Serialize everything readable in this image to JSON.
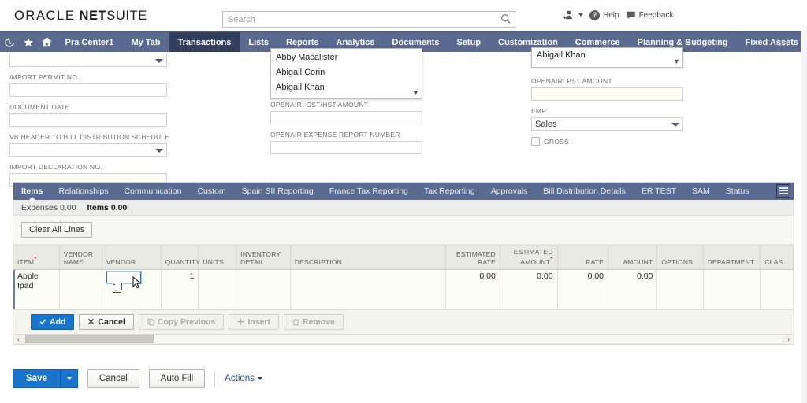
{
  "header": {
    "brand_oracle": "ORACLE",
    "brand_net": "NET",
    "brand_suite": "SUITE",
    "search_placeholder": "Search",
    "search_value": "",
    "help_label": "Help",
    "feedback_label": "Feedback"
  },
  "nav": {
    "items": [
      {
        "label": "Pra Center1",
        "active": false
      },
      {
        "label": "My Tab",
        "active": false
      },
      {
        "label": "Transactions",
        "active": true
      },
      {
        "label": "Lists",
        "active": false
      },
      {
        "label": "Reports",
        "active": false
      },
      {
        "label": "Analytics",
        "active": false
      },
      {
        "label": "Documents",
        "active": false
      },
      {
        "label": "Setup",
        "active": false
      },
      {
        "label": "Customization",
        "active": false
      },
      {
        "label": "Commerce",
        "active": false
      },
      {
        "label": "Planning & Budgeting",
        "active": false
      },
      {
        "label": "Fixed Assets",
        "active": false
      }
    ],
    "more": "..."
  },
  "form": {
    "left": [
      {
        "label": "",
        "type": "select",
        "value": ""
      },
      {
        "label": "IMPORT PERMIT NO.",
        "type": "text",
        "value": ""
      },
      {
        "label": "DOCUMENT DATE",
        "type": "text",
        "value": ""
      },
      {
        "label": "VB HEADER TO BILL DISTRIBUTION SCHEDULE",
        "type": "select",
        "value": ""
      },
      {
        "label": "IMPORT DECLARATION NO.",
        "type": "text",
        "value": ""
      }
    ],
    "mid": [
      {
        "label": "OPENAIR: GST/HST AMOUNT",
        "type": "text",
        "value": ""
      },
      {
        "label": "OPENAIR EXPENSE REPORT NUMBER",
        "type": "text",
        "value": ""
      }
    ],
    "right": [
      {
        "label": "OPENAIR: PST AMOUNT",
        "type": "text",
        "value": ""
      },
      {
        "label": "EMP",
        "type": "select",
        "value": "Sales"
      }
    ],
    "gross_label": "GROSS",
    "gross_checked": false
  },
  "autocomplete": {
    "items": [
      "Abby Macalister",
      "Abigail Corin",
      "Abigail Khan"
    ],
    "selected_right": "Abigail Khan"
  },
  "panel": {
    "tabs": [
      {
        "label": "Items",
        "active": true
      },
      {
        "label": "Relationships",
        "active": false
      },
      {
        "label": "Communication",
        "active": false
      },
      {
        "label": "Custom",
        "active": false
      },
      {
        "label": "Spain SII Reporting",
        "active": false
      },
      {
        "label": "France Tax Reporting",
        "active": false
      },
      {
        "label": "Tax Reporting",
        "active": false
      },
      {
        "label": "Approvals",
        "active": false
      },
      {
        "label": "Bill Distribution Details",
        "active": false
      },
      {
        "label": "ER TEST",
        "active": false
      },
      {
        "label": "SAM",
        "active": false
      },
      {
        "label": "Status",
        "active": false
      }
    ],
    "subtabs": [
      {
        "label": "Expenses 0.00",
        "active": false
      },
      {
        "label": "Items 0.00",
        "active": true
      }
    ],
    "clear_all_lines": "Clear All Lines"
  },
  "table": {
    "columns": [
      {
        "label": "ITEM",
        "required": true,
        "align": "l"
      },
      {
        "label": "VENDOR NAME",
        "required": false,
        "align": "l"
      },
      {
        "label": "VENDOR",
        "required": false,
        "align": "l"
      },
      {
        "label": "QUANTITY",
        "required": false,
        "align": "r"
      },
      {
        "label": "UNITS",
        "required": false,
        "align": "l"
      },
      {
        "label": "INVENTORY DETAIL",
        "required": false,
        "align": "l"
      },
      {
        "label": "DESCRIPTION",
        "required": false,
        "align": "l"
      },
      {
        "label": "ESTIMATED RATE",
        "required": false,
        "align": "r"
      },
      {
        "label": "ESTIMATED AMOUNT",
        "required": true,
        "align": "r"
      },
      {
        "label": "RATE",
        "required": false,
        "align": "r"
      },
      {
        "label": "AMOUNT",
        "required": false,
        "align": "r"
      },
      {
        "label": "OPTIONS",
        "required": false,
        "align": "l"
      },
      {
        "label": "DEPARTMENT",
        "required": false,
        "align": "l"
      },
      {
        "label": "CLAS",
        "required": false,
        "align": "l"
      }
    ],
    "rows": [
      {
        "item": "Apple Ipad",
        "vendor_name": "",
        "vendor": "",
        "quantity": "1",
        "units": "",
        "inventory_detail": "",
        "description": "",
        "estimated_rate": "0.00",
        "estimated_amount": "0.00",
        "rate": "0.00",
        "amount": "0.00",
        "options": "",
        "department": "",
        "clas": ""
      }
    ]
  },
  "line_buttons": [
    {
      "label": "Add",
      "state": "primary",
      "icon": "check-icon"
    },
    {
      "label": "Cancel",
      "state": "normal",
      "icon": "x-icon"
    },
    {
      "label": "Copy Previous",
      "state": "disabled",
      "icon": "copy-icon"
    },
    {
      "label": "Insert",
      "state": "disabled",
      "icon": "plus-icon"
    },
    {
      "label": "Remove",
      "state": "disabled",
      "icon": "trash-icon"
    }
  ],
  "footer": {
    "save": "Save",
    "cancel": "Cancel",
    "auto_fill": "Auto Fill",
    "actions": "Actions"
  },
  "colors": {
    "nav_bg": "#5b6a90",
    "nav_active": "#323e5e",
    "primary_button": "#1874cd",
    "link": "#1a4f8a"
  }
}
